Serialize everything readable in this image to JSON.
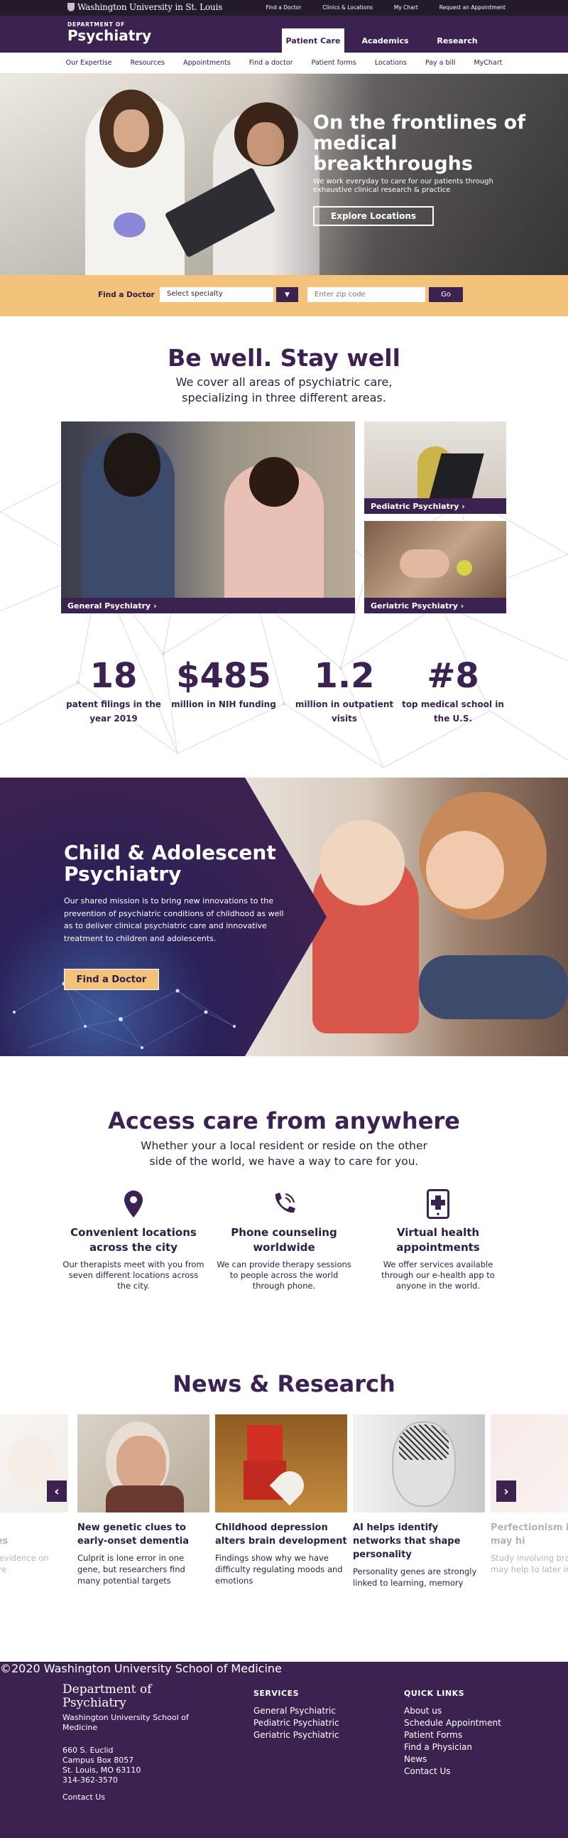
{
  "topbar": {
    "logo": "Washington University in St. Louis",
    "links": [
      "Find a Doctor",
      "Clinics & Locations",
      "My Chart",
      "Request an Appointment"
    ]
  },
  "header": {
    "dept": "DEPARTMENT OF",
    "name": "Psychiatry",
    "nav": [
      "Patient Care",
      "Academics",
      "Research"
    ],
    "active": "Patient Care"
  },
  "subnav": [
    "Our Expertise",
    "Resources",
    "Appointments",
    "Find a doctor",
    "Patient forms",
    "Locations",
    "Pay a bill",
    "MyChart"
  ],
  "hero": {
    "title": "On the frontlines of medical breakthroughs",
    "text": "We work everyday to care for our patients through exhaustive clinical research & practice",
    "cta": "Explore Locations"
  },
  "finder": {
    "label": "Find a Doctor",
    "specialty": "Select specialty",
    "zip_placeholder": "Enter zip code",
    "go": "Go"
  },
  "bewell": {
    "title": "Be well. Stay well",
    "subtitle": "We cover all areas of psychiatric care, specializing in three different areas.",
    "cards": [
      "General Psychiatry",
      "Pediatric Psychiatry",
      "Geriatric Psychiatry"
    ]
  },
  "stats": [
    {
      "num": "18",
      "desc": "patent filings in the year 2019"
    },
    {
      "num": "$485",
      "desc": "million in NIH funding"
    },
    {
      "num": "1.2",
      "desc": "million in outpatient visits"
    },
    {
      "num": "#8",
      "desc": "top medical school in the U.S."
    }
  ],
  "child": {
    "title": "Child & Adolescent Psychiatry",
    "text": "Our shared mission is to bring new innovations to the prevention of psychiatric conditions of childhood as well as to deliver clinical psychiatric care and innovative treatment to children and adolescents.",
    "cta": "Find a Doctor"
  },
  "access": {
    "title": "Access care from anywhere",
    "subtitle": "Whether your a local resident or reside on the other side of the world, we have a way to care for you.",
    "features": [
      {
        "icon": "location-pin-icon",
        "title": "Convenient locations across the city",
        "text": "Our therapists meet with you from seven different locations across the city."
      },
      {
        "icon": "phone-icon",
        "title": "Phone counseling worldwide",
        "text": "We can provide therapy sessions to people across the world through phone."
      },
      {
        "icon": "tablet-health-icon",
        "title": "Virtual health appointments",
        "text": "We offer services available through our e-health app to anyone in the world."
      }
    ]
  },
  "news": {
    "title": "News & Research",
    "items": [
      {
        "title": "Genes drive abnormalities",
        "text": "Reveals strong evidence on how they explore"
      },
      {
        "title": "New genetic clues to early-onset dementia",
        "text": "Culprit is lone error in one gene, but researchers find many potential targets"
      },
      {
        "title": "Childhood depression alters brain development",
        "text": "Findings show why we have difficulty regulating moods and emotions"
      },
      {
        "title": "AI helps identify networks that shape personality",
        "text": "Personality genes are strongly linked to learning, memory"
      },
      {
        "title": "Perfectionism in children may hi",
        "text": "Study involving brain scans may help to later in life"
      }
    ]
  },
  "footer": {
    "name": "Department of Psychiatry",
    "school": "Washington University School of Medicine",
    "address": [
      "660 S. Euclid",
      "Campus Box 8057",
      "St. Louis, MO 63110",
      "314-362-3570"
    ],
    "contact": "Contact Us",
    "services_title": "SERVICES",
    "services": [
      "General Psychiatric",
      "Pediatric Psychiatric",
      "Geriatric Psychiatric"
    ],
    "quick_title": "QUICK LINKS",
    "quick": [
      "About us",
      "Schedule Appointment",
      "Patient Forms",
      "Find a Physician",
      "News",
      "Contact Us"
    ],
    "copyright": "©2020 Washington University School of Medicine"
  },
  "colors": {
    "primary": "#3b2251",
    "accent": "#f3c27b",
    "topbar": "#231a2c"
  }
}
